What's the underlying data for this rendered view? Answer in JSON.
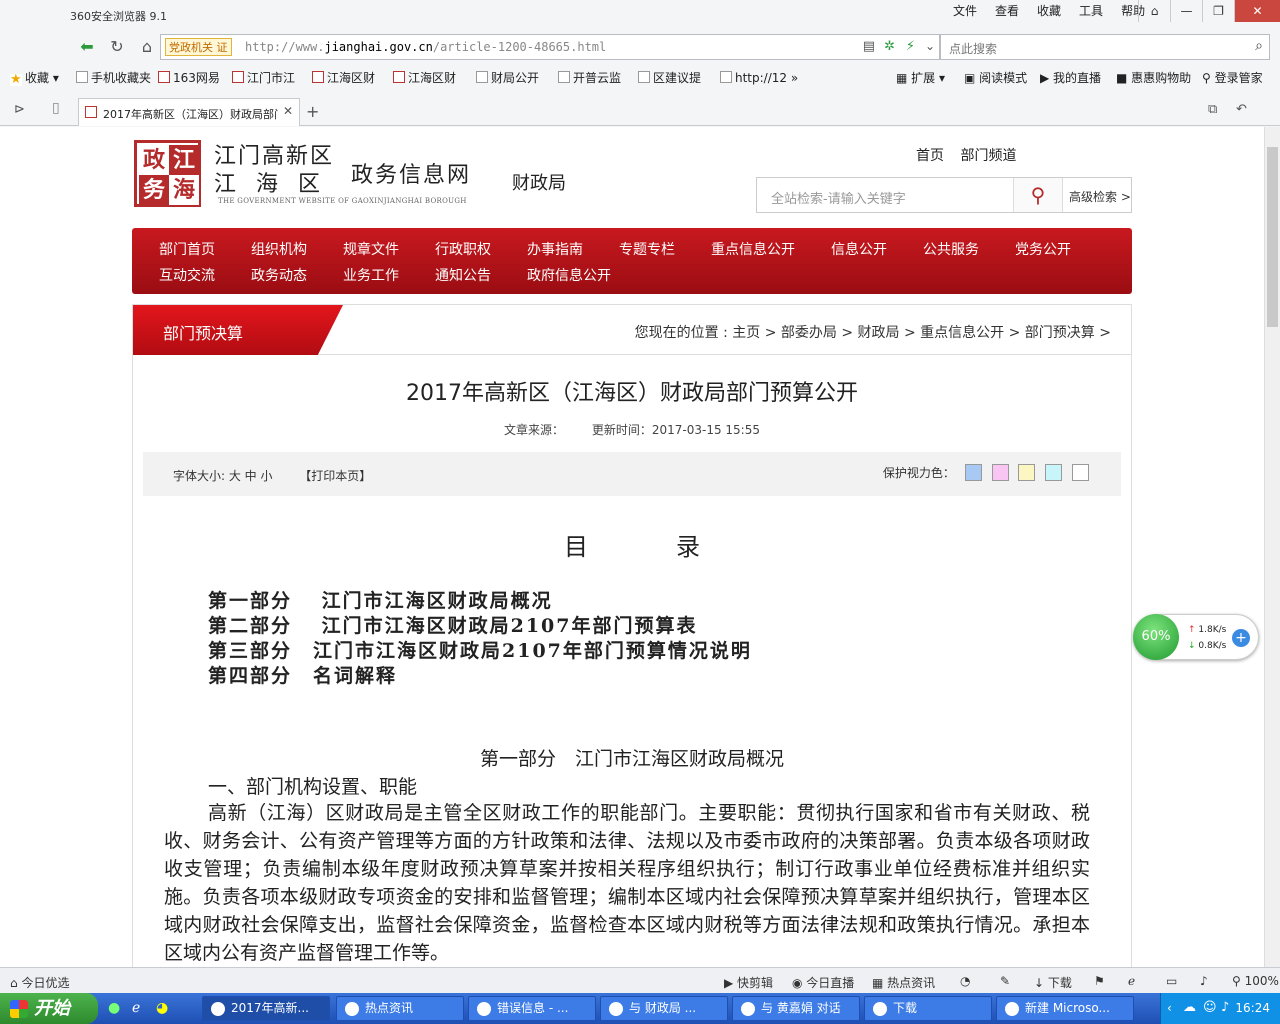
{
  "browser": {
    "app_title": "360安全浏览器 9.1",
    "menu": [
      "文件",
      "查看",
      "收藏",
      "工具",
      "帮助"
    ],
    "address_badge": "党政机关",
    "url_prefix": "http://www.",
    "url_domain": "jianghai.gov.cn",
    "url_path": "/article-1200-48665.html",
    "search_placeholder": "点此搜索",
    "bookmarks": [
      "收藏",
      "手机收藏夹",
      "163网易",
      "江门市江",
      "江海区财",
      "江海区财",
      "财局公开",
      "开普云监",
      "区建议提",
      "http://12"
    ],
    "bookmarks_right": [
      "扩展",
      "阅读模式",
      "我的直播",
      "惠惠购物助",
      "登录管家"
    ],
    "tab_title": "2017年高新区（江海区）财政局部门预算公开"
  },
  "site": {
    "logo_chars": [
      "政",
      "江",
      "务",
      "海"
    ],
    "name_line1": "江门高新区",
    "name_line2": "江  海  区",
    "name_suffix": "政务信息网",
    "name_en": "THE GOVERNMENT WEBSITE OF GAOXINJIANGHAI BOROUGH",
    "dept": "财政局",
    "top_links": [
      "首页",
      "部门频道"
    ],
    "search_placeholder": "全站检索-请输入关键字",
    "advanced_search": "高级检索 >"
  },
  "nav": {
    "row1": [
      "部门首页",
      "组织机构",
      "规章文件",
      "行政职权",
      "办事指南",
      "专题专栏",
      "重点信息公开",
      "信息公开",
      "公共服务",
      "党务公开"
    ],
    "row2": [
      "互动交流",
      "政务动态",
      "业务工作",
      "通知公告",
      "政府信息公开"
    ]
  },
  "panel": {
    "tab": "部门预决算",
    "breadcrumb": "您现在的位置 : 主页 > 部委办局 > 财政局 > 重点信息公开 > 部门预决算 >"
  },
  "article": {
    "title": "2017年高新区（江海区）财政局部门预算公开",
    "source_label": "文章来源：",
    "updated": "更新时间：2017-03-15 15:55",
    "font_size_label": "字体大小: 大 中 小",
    "print": "【打印本页】",
    "eye_label": "保护视力色：",
    "eye_colors": [
      "#a9c9f5",
      "#f9c6f3",
      "#fbf6c2",
      "#c8f5f9",
      "#ffffff"
    ],
    "toc_heading": "目录",
    "toc": [
      "第一部分　 江门市江海区财政局概况",
      "第二部分　 江门市江海区财政局2107年部门预算表",
      "第三部分　江门市江海区财政局2107年部门预算情况说明",
      "第四部分　名词解释"
    ],
    "section_heading": "第一部分　江门市江海区财政局概况",
    "sub_heading": "一、部门机构设置、职能",
    "paragraph": "高新（江海）区财政局是主管全区财政工作的职能部门。主要职能：贯彻执行国家和省市有关财政、税收、财务会计、公有资产管理等方面的方针政策和法律、法规以及市委市政府的决策部署。负责本级各项财政收支管理；负责编制本级年度财政预决算草案并按相关程序组织执行；制订行政事业单位经费标准并组织实施。负责各项本级财政专项资金的安排和监督管理；编制本区域内社会保障预决算草案并组织执行，管理本区域内财政社会保障支出，监督社会保障资金，监督检查本区域内财税等方面法律法规和政策执行情况。承担本区域内公有资产监督管理工作等。"
  },
  "netmeter": {
    "percent": "60%",
    "up": "1.8K/s",
    "down": "0.8K/s"
  },
  "statusbar": {
    "left": "今日优选",
    "items": [
      "快剪辑",
      "今日直播",
      "热点资讯",
      "下载",
      "100%"
    ]
  },
  "taskbar": {
    "start": "开始",
    "tasks": [
      "2017年高新...",
      "热点资讯",
      "错误信息 - ...",
      "与 财政局 ...",
      "与 黄嘉娟 对话",
      "下载",
      "新建 Microso..."
    ],
    "clock": "16:24"
  }
}
